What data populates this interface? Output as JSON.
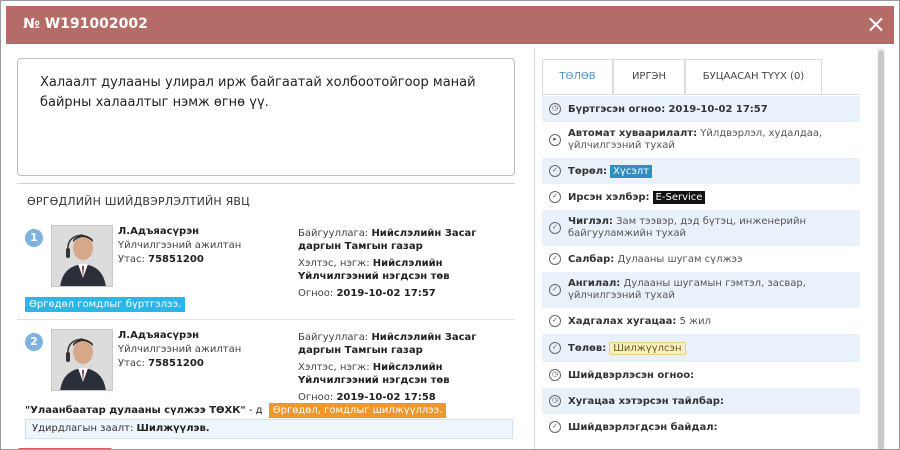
{
  "window": {
    "title": "№ W191002002",
    "close_icon": "×"
  },
  "complaint": {
    "text": "Халаалт дулааны улирал ирж байгаатай холбоотойгоор манай байрны халаалтыг нэмж өгнө үү."
  },
  "process": {
    "title": "ӨРГӨДЛИЙН ШИЙДВЭРЛЭЛТИЙН ЯВЦ",
    "steps": [
      {
        "number": "1",
        "name": "Л.Адъяасүрэн",
        "role": "Үйлчилгээний ажилтан",
        "phone_label": "Утас:",
        "phone": "75851200",
        "org_label": "Байгууллага:",
        "org": "Нийслэлийн Засаг даргын Тамгын газар",
        "dept_label": "Хэлтэс, нэгж:",
        "dept": "Нийслэлийн Үйлчилгээний нэгдсэн төв",
        "date_label": "Огноо:",
        "date": "2019-10-02 17:57",
        "badge": "Өргөдөл гомдлыг бүртгэлээ."
      },
      {
        "number": "2",
        "name": "Л.Адъяасүрэн",
        "role": "Үйлчилгээний ажилтан",
        "phone_label": "Утас:",
        "phone": "75851200",
        "org_label": "Байгууллага:",
        "org": "Нийслэлийн Засаг даргын Тамгын газар",
        "dept_label": "Хэлтэс, нэгж:",
        "dept": "Нийслэлийн Үйлчилгээний нэгдсэн төв",
        "date_label": "Огноо:",
        "date": "2019-10-02 17:58",
        "target": "\"Улаанбаатар дулааны сүлжээ ТӨХК\"",
        "target_suffix": " - д",
        "badge": "Өргөдөл, гомдлыг шилжүүллээ.",
        "decision_label": "Удирдлагын заалт:",
        "decision": "Шилжүүлэв."
      }
    ]
  },
  "tabs": [
    {
      "label": "ТӨЛӨВ",
      "active": true
    },
    {
      "label": "ИРГЭН",
      "active": false
    },
    {
      "label": "БУЦААСАН ТҮҮХ (0)",
      "active": false
    }
  ],
  "details": {
    "registered": {
      "label": "Бүртгэсэн огноо:",
      "value": "2019-10-02 17:57"
    },
    "auto_assign": {
      "label": "Автомат хуваарилалт:",
      "value": "Үйлдвэрлэл, худалдаа, үйлчилгээний тухай"
    },
    "type": {
      "label": "Төрөл:",
      "value": "Хүсэлт"
    },
    "channel": {
      "label": "Ирсэн хэлбэр:",
      "value": "E-Service"
    },
    "direction": {
      "label": "Чиглэл:",
      "value": "Зам тээвэр, дэд бүтэц, инженерийн байгууламжийн тухай"
    },
    "branch": {
      "label": "Салбар:",
      "value": "Дулааны шугам сүлжээ"
    },
    "category": {
      "label": "Ангилал:",
      "value": "Дулааны шугамын гэмтэл, засвар, үйлчилгээний тухай"
    },
    "deadline": {
      "label": "Хадгалах хугацаа:",
      "value": "5 жил"
    },
    "status": {
      "label": "Төлөв:",
      "value": "Шилжүүлсэн"
    },
    "resolved_date": {
      "label": "Шийдвэрлэсэн огноо:"
    },
    "overdue": {
      "label": "Хугацаа хэтэрсэн тайлбар:"
    },
    "resolved_state": {
      "label": "Шийдвэрлэгдсэн байдал:"
    }
  },
  "colors": {
    "titlebar": "#b56b68",
    "badge_blue": "#2bb6e8",
    "badge_orange": "#f0962a",
    "tag_type": "#2f8ec3",
    "row_alt": "#e9f2fa"
  }
}
